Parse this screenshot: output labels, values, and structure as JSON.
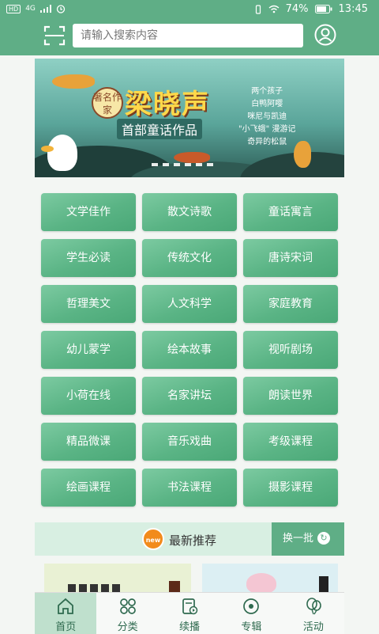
{
  "status_bar": {
    "hd": "HD",
    "network": "4G",
    "battery": "74%",
    "time": "13:45"
  },
  "search": {
    "placeholder": "请输入搜索内容"
  },
  "banner": {
    "tag": "著名作家",
    "author": "梁晓声",
    "subtitle": "首部童话作品",
    "poem_lines": [
      "两个孩子",
      "白鸭阿嘤",
      "咪尼与凯迪",
      "\"小飞蛾\" 漫游记",
      "奇异的松鼠"
    ]
  },
  "categories": [
    "文学佳作",
    "散文诗歌",
    "童话寓言",
    "学生必读",
    "传统文化",
    "唐诗宋词",
    "哲理美文",
    "人文科学",
    "家庭教育",
    "幼儿蒙学",
    "绘本故事",
    "视听剧场",
    "小荷在线",
    "名家讲坛",
    "朗读世界",
    "精品微课",
    "音乐戏曲",
    "考级课程",
    "绘画课程",
    "书法课程",
    "摄影课程"
  ],
  "recommend": {
    "badge": "new",
    "title": "最新推荐",
    "refresh": "换一批"
  },
  "bottom_nav": [
    {
      "label": "首页",
      "icon": "home-icon",
      "active": true
    },
    {
      "label": "分类",
      "icon": "category-icon",
      "active": false
    },
    {
      "label": "续播",
      "icon": "resume-play-icon",
      "active": false
    },
    {
      "label": "专辑",
      "icon": "album-icon",
      "active": false
    },
    {
      "label": "活动",
      "icon": "balloon-icon",
      "active": false
    }
  ],
  "colors": {
    "primary": "#5fae86",
    "tile": "#5ab485",
    "badge": "#f28b1c"
  }
}
